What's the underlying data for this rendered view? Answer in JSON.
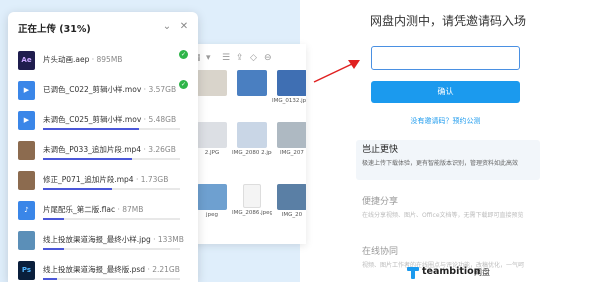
{
  "upload_panel": {
    "title": "正在上传 (31%)",
    "files": [
      {
        "name": "片头动画.aep",
        "size": "895MB",
        "icon": "ae-file-icon",
        "done": true
      },
      {
        "name": "已调色_C022_剪辑小样.mov",
        "size": "3.57GB",
        "icon": "video-file-icon",
        "done": true
      },
      {
        "name": "未调色_C025_剪辑小样.mov",
        "size": "5.48GB",
        "icon": "video-file-icon",
        "done": false,
        "progress": 0.7
      },
      {
        "name": "未调色_P033_追加片段.mp4",
        "size": "3.26GB",
        "icon": "video-thumbnail-icon",
        "done": false,
        "progress": 0.65
      },
      {
        "name": "修正_P071_追加片段.mp4",
        "size": "1.73GB",
        "icon": "video-thumbnail-icon",
        "done": false,
        "progress": 0.5
      },
      {
        "name": "片尾配乐_第二版.flac",
        "size": "87MB",
        "icon": "audio-file-icon",
        "done": false,
        "progress": 0.15
      },
      {
        "name": "线上投放渠道海报_最终小样.jpg",
        "size": "133MB",
        "icon": "image-thumbnail-icon",
        "done": false,
        "progress": 0.15
      },
      {
        "name": "线上投放渠道海报_最终版.psd",
        "size": "2.21GB",
        "icon": "ps-file-icon",
        "done": false,
        "progress": 0.1
      }
    ]
  },
  "file_browser": {
    "items": [
      {
        "caption": "",
        "kind": "folder"
      },
      {
        "caption": "",
        "kind": "image"
      },
      {
        "caption": "IMG_0132.jpeg",
        "kind": "image"
      },
      {
        "caption": "IMG_207",
        "kind": "image"
      },
      {
        "caption": "2.JPG",
        "kind": "image"
      },
      {
        "caption": "IMG_2080 2.jpeg",
        "kind": "image"
      },
      {
        "caption": "IMG_207",
        "kind": "image"
      },
      {
        "caption": "jpeg",
        "kind": "image"
      },
      {
        "caption": "IMG_2086.jpeg",
        "kind": "doc"
      },
      {
        "caption": "IMG_20",
        "kind": "image"
      }
    ]
  },
  "invite": {
    "title": "网盘内测中，请凭邀请码入场",
    "input_value": "",
    "input_placeholder": "",
    "confirm_label": "确认",
    "links_text": "没有邀请码？预约公测"
  },
  "features": [
    {
      "title": "岂止更快",
      "desc": "极速上传下载体验，更有智能版本识别，管理资料如此高效",
      "active": true
    },
    {
      "title": "便捷分享",
      "desc": "在线分享视频、图片、Office文档等，无需下载即可直接预览",
      "active": false
    },
    {
      "title": "在线协同",
      "desc": "视频、图片工作者的在线圈点与评论功能，改稿优化，一气呵",
      "active": false
    }
  ],
  "brand": {
    "name": "teambition",
    "sub": "网盘"
  },
  "colors": {
    "accent": "#1b9aee",
    "progress": "#4b57d8",
    "success": "#2fb54a",
    "arrow": "#e02020"
  }
}
